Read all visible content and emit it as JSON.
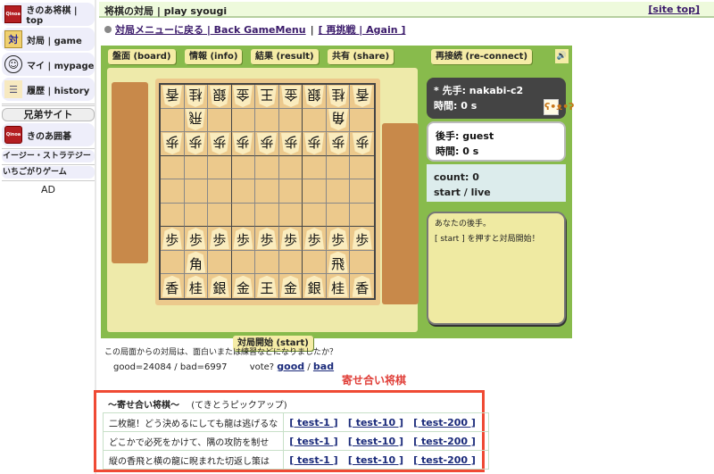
{
  "sidebar": {
    "items": [
      {
        "label": "きのあ将棋 | top",
        "icon": "kinoa-logo-icon",
        "icon_text": "Qinoa"
      },
      {
        "label": "対局 | game",
        "icon": "game-board-icon",
        "icon_text": "対"
      },
      {
        "label": "マイ | mypage",
        "icon": "face-icon",
        "icon_text": "☺"
      },
      {
        "label": "履歴 | history",
        "icon": "history-icon",
        "icon_text": "☰"
      }
    ],
    "brother_sites_label": "兄弟サイト",
    "igo": {
      "label": "きのあ囲碁",
      "icon_text": "Qinoa"
    },
    "links": [
      "イージー・ストラテジー",
      "いちごがりゲーム"
    ],
    "ad": "AD"
  },
  "header": {
    "title": "将棋の対局 | play syougi",
    "site_top": "[site top]",
    "back_link": "対局メニューに戻る | Back GameMenu",
    "separator": "|",
    "again_link": "[ 再挑戦 | Again ]"
  },
  "toolbar": {
    "board": "盤面 (board)",
    "info": "情報 (info)",
    "result": "結果 (result)",
    "share": "共有 (share)",
    "reconnect": "再接続 (re-connect)",
    "sound_icon": "🔊"
  },
  "board": {
    "gote_pieces": {
      "row1": [
        "香",
        "桂",
        "銀",
        "金",
        "王",
        "金",
        "銀",
        "桂",
        "香"
      ],
      "row2": [
        "",
        "飛",
        "",
        "",
        "",
        "",
        "",
        "角",
        ""
      ],
      "row3": [
        "歩",
        "歩",
        "歩",
        "歩",
        "歩",
        "歩",
        "歩",
        "歩",
        "歩"
      ]
    },
    "sente_pieces": {
      "row7": [
        "歩",
        "歩",
        "歩",
        "歩",
        "歩",
        "歩",
        "歩",
        "歩",
        "歩"
      ],
      "row8": [
        "",
        "角",
        "",
        "",
        "",
        "",
        "",
        "飛",
        ""
      ],
      "row9": [
        "香",
        "桂",
        "銀",
        "金",
        "王",
        "金",
        "銀",
        "桂",
        "香"
      ]
    },
    "start_button": "対局開始 (start)"
  },
  "players": {
    "sente": {
      "name_line": "* 先手: nakabi-c2",
      "time_line": "時間: 0 s"
    },
    "gote": {
      "name_line": "後手: guest",
      "time_line": "時間: 0 s"
    },
    "count_line": "count: 0",
    "status_line": "start / live"
  },
  "message": {
    "line1": "あなたの後手。",
    "line2": "[ start ] を押すと対局開始！"
  },
  "vote": {
    "question": "この局面からの対局は、面白いまたは練習などになりましたか？",
    "counts": "good=24084 / bad=6997",
    "prompt": "vote?",
    "good": "good",
    "slash": "/",
    "bad": "bad"
  },
  "yose_label": "寄せ合い将棋",
  "pickup": {
    "title": "～寄せ合い将棋～",
    "subtitle": "(てきとうピックアップ)",
    "rows": [
      {
        "text": "二枚龍！どう決めるにしても龍は逃げるな",
        "links": [
          "[ test-1 ]",
          "[ test-10 ]",
          "[ test-200 ]"
        ]
      },
      {
        "text": "どこかで必死をかけて、隅の攻防を制せ",
        "links": [
          "[ test-1 ]",
          "[ test-10 ]",
          "[ test-200 ]"
        ]
      },
      {
        "text": "縦の香飛と横の龍に睨まれた切返し策は",
        "links": [
          "[ test-1 ]",
          "[ test-10 ]",
          "[ test-200 ]"
        ]
      }
    ]
  }
}
